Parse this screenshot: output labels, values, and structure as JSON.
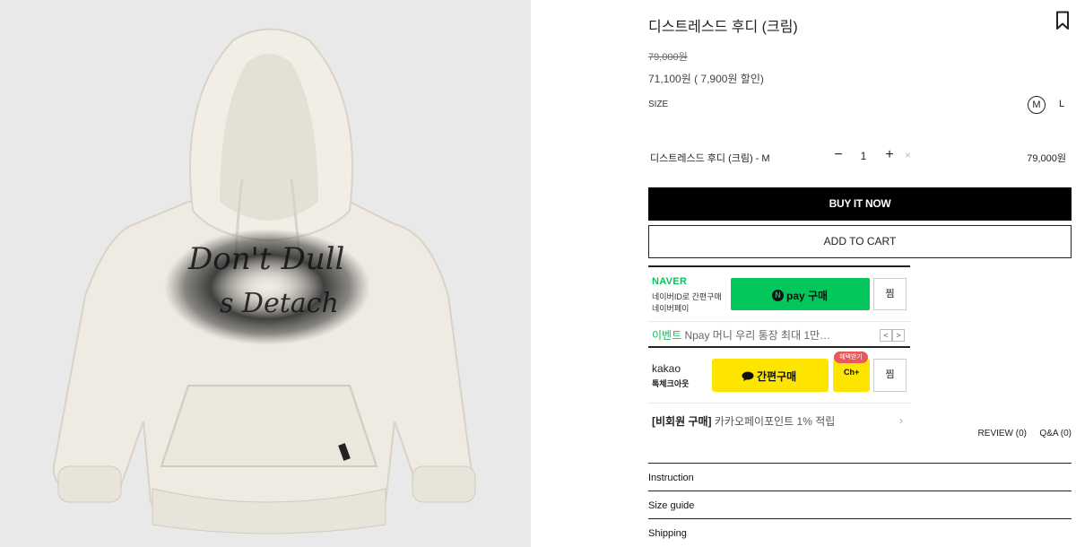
{
  "product": {
    "title": "디스트레스드 후디 (크림)",
    "price_original": "79,000원",
    "price_sale": "71,100원 ( 7,900원 할인)",
    "size_label": "SIZE",
    "sizes": [
      "M",
      "L"
    ],
    "selected_size": "M"
  },
  "selection": {
    "name": "디스트레스드 후디 (크림) - M",
    "minus": "−",
    "quantity": "1",
    "plus": "+",
    "remove": "×",
    "price": "79,000원"
  },
  "actions": {
    "buy_now": "BUY IT NOW",
    "add_to_cart": "ADD TO CART"
  },
  "naver_pay": {
    "brand": "NAVER",
    "desc_line1": "네이버ID로 간편구매",
    "desc_line2": "네이버페이",
    "button_n": "N",
    "button_label": "pay 구매",
    "zzim": "찜",
    "event_tag": "이벤트",
    "event_text": " Npay 머니 우리 통장 최대 1만…",
    "prev": "<",
    "next": ">"
  },
  "kakao_pay": {
    "brand": "kakao",
    "sub": "톡체크아웃",
    "button_label": "간편구매",
    "channel_badge": "혜택받기",
    "channel_icon": "Ch+",
    "zzim": "찜",
    "promo_tag": "[비회원 구매]",
    "promo_text": " 카카오페이포인트 1% 적립",
    "chevron": "›"
  },
  "links": {
    "review": "REVIEW (0)",
    "qa": "Q&A (0)"
  },
  "info_sections": [
    "Instruction",
    "Size guide",
    "Shipping"
  ],
  "colors": {
    "naver_green": "#03c75a",
    "kakao_yellow": "#fee500",
    "buy_button": "#000000",
    "image_bg": "#e9e9e9"
  }
}
